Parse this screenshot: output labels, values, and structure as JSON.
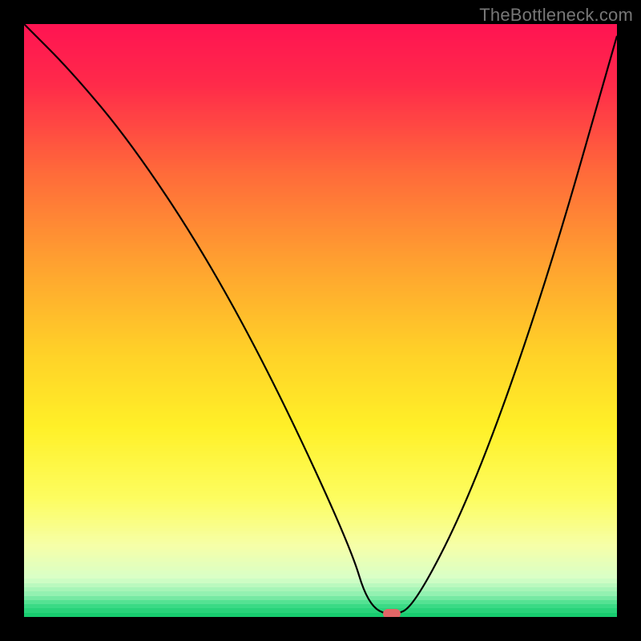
{
  "watermark": "TheBottleneck.com",
  "marker_color": "#e06666",
  "chart_data": {
    "type": "line",
    "title": "",
    "xlabel": "",
    "ylabel": "",
    "xlim": [
      0,
      100
    ],
    "ylim": [
      0,
      100
    ],
    "grid": false,
    "legend": false,
    "series": [
      {
        "name": "bottleneck-curve",
        "x": [
          0,
          8,
          18,
          30,
          42,
          55,
          58,
          62,
          66,
          76,
          88,
          100
        ],
        "values": [
          100,
          92,
          80,
          62,
          40,
          12,
          2,
          0,
          2,
          22,
          56,
          98
        ]
      }
    ],
    "annotations": [
      {
        "name": "optimal-marker",
        "x": 62,
        "y": 0.5
      }
    ],
    "background_gradient_stops": [
      {
        "pos": 0.0,
        "color": "#ff1452"
      },
      {
        "pos": 0.1,
        "color": "#ff2a4a"
      },
      {
        "pos": 0.25,
        "color": "#ff6a3a"
      },
      {
        "pos": 0.4,
        "color": "#ffa030"
      },
      {
        "pos": 0.55,
        "color": "#ffd028"
      },
      {
        "pos": 0.68,
        "color": "#fff028"
      },
      {
        "pos": 0.8,
        "color": "#fdfd60"
      },
      {
        "pos": 0.88,
        "color": "#f6ffa8"
      },
      {
        "pos": 0.935,
        "color": "#d8ffc8"
      },
      {
        "pos": 0.962,
        "color": "#90f0b0"
      },
      {
        "pos": 0.98,
        "color": "#3fdc88"
      },
      {
        "pos": 1.0,
        "color": "#10c86a"
      }
    ]
  }
}
